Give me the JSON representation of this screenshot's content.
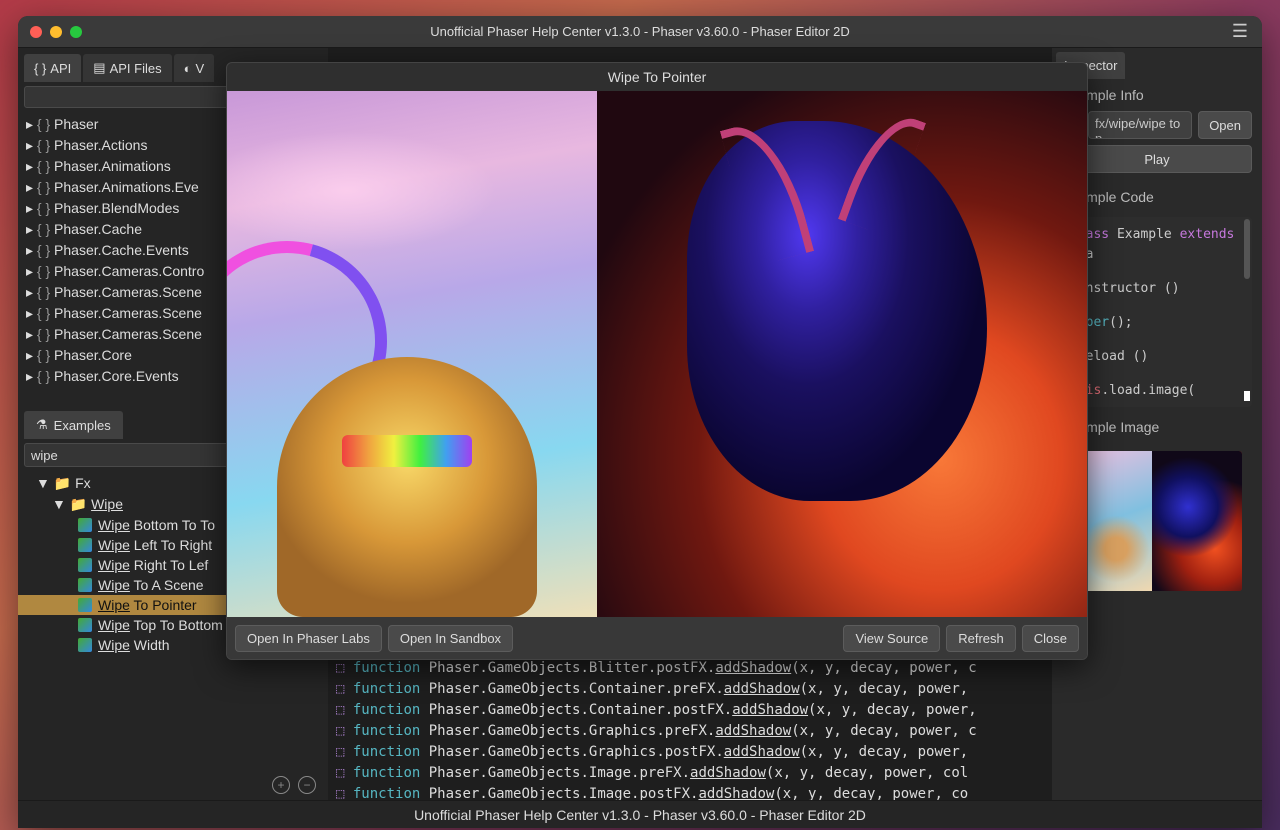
{
  "window": {
    "title": "Unofficial Phaser Help Center v1.3.0 - Phaser v3.60.0 - Phaser Editor 2D"
  },
  "topTabs": {
    "api": "API",
    "apiFiles": "API Files",
    "partial": "V"
  },
  "apiTree": [
    "Phaser",
    "Phaser.Actions",
    "Phaser.Animations",
    "Phaser.Animations.Eve",
    "Phaser.BlendModes",
    "Phaser.Cache",
    "Phaser.Cache.Events",
    "Phaser.Cameras.Contro",
    "Phaser.Cameras.Scene",
    "Phaser.Cameras.Scene",
    "Phaser.Cameras.Scene",
    "Phaser.Core",
    "Phaser.Core.Events"
  ],
  "examplesPanel": {
    "tab": "Examples",
    "search": "wipe"
  },
  "examplesTree": {
    "root": "Fx",
    "folder": "Wipe",
    "items": [
      {
        "prefix": "Wipe",
        "rest": " Bottom To To"
      },
      {
        "prefix": "Wipe",
        "rest": " Left To Right"
      },
      {
        "prefix": "Wipe",
        "rest": " Right To Lef"
      },
      {
        "prefix": "Wipe",
        "rest": " To A Scene"
      },
      {
        "prefix": "Wipe",
        "rest": " To Pointer"
      },
      {
        "prefix": "Wipe",
        "rest": " Top To Bottom"
      },
      {
        "prefix": "Wipe",
        "rest": " Width"
      }
    ],
    "selectedIdx": 4
  },
  "codeLines": [
    {
      "owner": "Phaser.GameObjects.Blitter.postFX.",
      "method": "addShadow",
      "args": "(x, y, decay, power, c"
    },
    {
      "owner": "Phaser.GameObjects.Container.preFX.",
      "method": "addShadow",
      "args": "(x, y, decay, power,"
    },
    {
      "owner": "Phaser.GameObjects.Container.postFX.",
      "method": "addShadow",
      "args": "(x, y, decay, power,"
    },
    {
      "owner": "Phaser.GameObjects.Graphics.preFX.",
      "method": "addShadow",
      "args": "(x, y, decay, power, c"
    },
    {
      "owner": "Phaser.GameObjects.Graphics.postFX.",
      "method": "addShadow",
      "args": "(x, y, decay, power,"
    },
    {
      "owner": "Phaser.GameObjects.Image.preFX.",
      "method": "addShadow",
      "args": "(x, y, decay, power, col"
    },
    {
      "owner": "Phaser.GameObjects.Image.postFX.",
      "method": "addShadow",
      "args": "(x, y, decay, power, co"
    }
  ],
  "right": {
    "tab": "Inspector",
    "info": {
      "title": "Example Info",
      "pathLabel": "Path",
      "pathValue": "fx/wipe/wipe to p",
      "open": "Open",
      "play": "Play"
    },
    "code": {
      "title": "Example Code",
      "line1a": "class",
      "line1b": " Example ",
      "line1c": "extends",
      "line1d": " Pha",
      "line2": "    constructor ()",
      "line3a": "        super",
      "line3b": "();",
      "line4": "    preload ()",
      "line5a": "        this",
      "line5b": ".load.image("
    },
    "image": {
      "title": "Example Image"
    }
  },
  "footer": "Unofficial Phaser Help Center v1.3.0 - Phaser v3.60.0 - Phaser Editor 2D",
  "modal": {
    "title": "Wipe To Pointer",
    "buttons": {
      "labs": "Open In Phaser Labs",
      "sandbox": "Open In Sandbox",
      "viewSource": "View Source",
      "refresh": "Refresh",
      "close": "Close"
    }
  }
}
